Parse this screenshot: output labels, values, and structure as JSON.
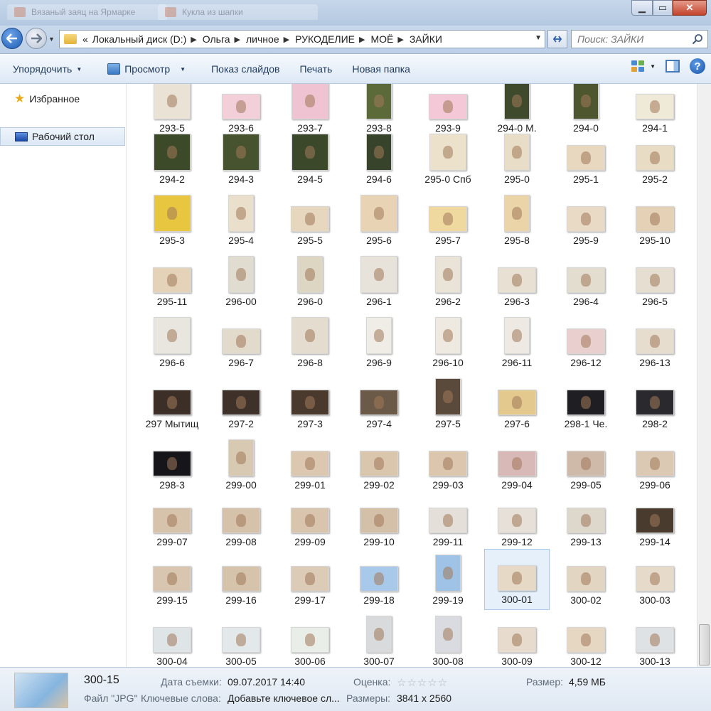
{
  "titlebar": {
    "ghost_tabs": [
      "Вязаный заяц на Ярмарке",
      "Кукла из шапки"
    ]
  },
  "nav": {
    "back_icon": "back-arrow-icon",
    "forward_icon": "forward-arrow-icon"
  },
  "address": {
    "prefix": "«",
    "crumbs": [
      "Локальный диск (D:)",
      "Ольга",
      "личное",
      "РУКОДЕЛИЕ",
      "МОЁ",
      "ЗАЙКИ"
    ]
  },
  "search": {
    "placeholder": "Поиск: ЗАЙКИ"
  },
  "toolbar": {
    "organize": "Упорядочить",
    "view": "Просмотр",
    "slideshow": "Показ слайдов",
    "print": "Печать",
    "new_folder": "Новая папка"
  },
  "sidebar": {
    "favorites": "Избранное",
    "desktop": "Рабочий стол"
  },
  "files": {
    "selected": "300-01",
    "columns": 8,
    "rows": [
      [
        {
          "name": "293-5",
          "shape": "sq",
          "color": "#e9e2d5"
        },
        {
          "name": "293-6",
          "shape": "land",
          "color": "#f2cfd9"
        },
        {
          "name": "293-7",
          "shape": "sq",
          "color": "#efc3d1"
        },
        {
          "name": "293-8",
          "shape": "port",
          "color": "#5c6a3a"
        },
        {
          "name": "293-9",
          "shape": "land",
          "color": "#f4c8d6"
        },
        {
          "name": "294-0 М.",
          "shape": "port",
          "color": "#3f4a2c"
        },
        {
          "name": "294-0",
          "shape": "port",
          "color": "#4e5630"
        },
        {
          "name": "294-1",
          "shape": "land",
          "color": "#efe9d8"
        }
      ],
      [
        {
          "name": "294-2",
          "shape": "sq",
          "color": "#3c4a29"
        },
        {
          "name": "294-3",
          "shape": "sq",
          "color": "#46532e"
        },
        {
          "name": "294-5",
          "shape": "sq",
          "color": "#3b492a"
        },
        {
          "name": "294-6",
          "shape": "port",
          "color": "#37432a"
        },
        {
          "name": "295-0 Спб",
          "shape": "sq",
          "color": "#ece2cc"
        },
        {
          "name": "295-0",
          "shape": "port",
          "color": "#e8ddc6"
        },
        {
          "name": "295-1",
          "shape": "land",
          "color": "#e7d8bf"
        },
        {
          "name": "295-2",
          "shape": "land",
          "color": "#e9dcc4"
        }
      ],
      [
        {
          "name": "295-3",
          "shape": "sq",
          "color": "#e8c640"
        },
        {
          "name": "295-4",
          "shape": "port",
          "color": "#e9dfca"
        },
        {
          "name": "295-5",
          "shape": "land",
          "color": "#e6d7be"
        },
        {
          "name": "295-6",
          "shape": "sq",
          "color": "#e8d4b5"
        },
        {
          "name": "295-7",
          "shape": "land",
          "color": "#f0d99e"
        },
        {
          "name": "295-8",
          "shape": "port",
          "color": "#ead4a8"
        },
        {
          "name": "295-9",
          "shape": "land",
          "color": "#e9dac5"
        },
        {
          "name": "295-10",
          "shape": "land",
          "color": "#e4d1b6"
        }
      ],
      [
        {
          "name": "295-11",
          "shape": "land",
          "color": "#e4d2b9"
        },
        {
          "name": "296-00",
          "shape": "port",
          "color": "#e0ddd0"
        },
        {
          "name": "296-0",
          "shape": "port",
          "color": "#ddd6c3"
        },
        {
          "name": "296-1",
          "shape": "sq",
          "color": "#e7e3da"
        },
        {
          "name": "296-2",
          "shape": "port",
          "color": "#e9e3d8"
        },
        {
          "name": "296-3",
          "shape": "land",
          "color": "#e7e0d3"
        },
        {
          "name": "296-4",
          "shape": "land",
          "color": "#e3ddd0"
        },
        {
          "name": "296-5",
          "shape": "land",
          "color": "#e6dfd1"
        }
      ],
      [
        {
          "name": "296-6",
          "shape": "sq",
          "color": "#e9e6e0"
        },
        {
          "name": "296-7",
          "shape": "land",
          "color": "#e2dacb"
        },
        {
          "name": "296-8",
          "shape": "sq",
          "color": "#e3dccf"
        },
        {
          "name": "296-9",
          "shape": "port",
          "color": "#f0ede6"
        },
        {
          "name": "296-10",
          "shape": "port",
          "color": "#efeae1"
        },
        {
          "name": "296-11",
          "shape": "port",
          "color": "#eeeae3"
        },
        {
          "name": "296-12",
          "shape": "land",
          "color": "#eacfcf"
        },
        {
          "name": "296-13",
          "shape": "land",
          "color": "#e6ddcf"
        }
      ],
      [
        {
          "name": "297 Мытищ",
          "shape": "land",
          "color": "#3b2f27"
        },
        {
          "name": "297-2",
          "shape": "land",
          "color": "#3d3129"
        },
        {
          "name": "297-3",
          "shape": "land",
          "color": "#4a3a2e"
        },
        {
          "name": "297-4",
          "shape": "land",
          "color": "#6b5a48"
        },
        {
          "name": "297-5",
          "shape": "port",
          "color": "#5a4a3b"
        },
        {
          "name": "297-6",
          "shape": "land",
          "color": "#e3c98d"
        },
        {
          "name": "298-1 Че.",
          "shape": "land",
          "color": "#1f1f23"
        },
        {
          "name": "298-2",
          "shape": "land",
          "color": "#2a2a2e"
        }
      ],
      [
        {
          "name": "298-3",
          "shape": "land",
          "color": "#16161a"
        },
        {
          "name": "299-00",
          "shape": "port",
          "color": "#d8c9b2"
        },
        {
          "name": "299-01",
          "shape": "land",
          "color": "#dcc7b0"
        },
        {
          "name": "299-02",
          "shape": "land",
          "color": "#dac5ad"
        },
        {
          "name": "299-03",
          "shape": "land",
          "color": "#dcc6ae"
        },
        {
          "name": "299-04",
          "shape": "land",
          "color": "#d9b8b8"
        },
        {
          "name": "299-05",
          "shape": "land",
          "color": "#cfb9a8"
        },
        {
          "name": "299-06",
          "shape": "land",
          "color": "#dbc9b4"
        }
      ],
      [
        {
          "name": "299-07",
          "shape": "land",
          "color": "#d7c3ac"
        },
        {
          "name": "299-08",
          "shape": "land",
          "color": "#d6c2aa"
        },
        {
          "name": "299-09",
          "shape": "land",
          "color": "#d9c5ae"
        },
        {
          "name": "299-10",
          "shape": "land",
          "color": "#d4c0a8"
        },
        {
          "name": "299-11",
          "shape": "land",
          "color": "#e4dfd8"
        },
        {
          "name": "299-12",
          "shape": "land",
          "color": "#e6e0d8"
        },
        {
          "name": "299-13",
          "shape": "land",
          "color": "#ded7cc"
        },
        {
          "name": "299-14",
          "shape": "land",
          "color": "#4a3b2f"
        }
      ],
      [
        {
          "name": "299-15",
          "shape": "land",
          "color": "#d8c6b0"
        },
        {
          "name": "299-16",
          "shape": "land",
          "color": "#d6c3ac"
        },
        {
          "name": "299-17",
          "shape": "land",
          "color": "#dccbb6"
        },
        {
          "name": "299-18",
          "shape": "land",
          "color": "#a8c9ea"
        },
        {
          "name": "299-19",
          "shape": "port",
          "color": "#9fc3e6"
        },
        {
          "name": "300-01",
          "shape": "land",
          "color": "#e6d9c6"
        },
        {
          "name": "300-02",
          "shape": "land",
          "color": "#e2d5c2"
        },
        {
          "name": "300-03",
          "shape": "land",
          "color": "#e6dacb"
        }
      ],
      [
        {
          "name": "300-04",
          "shape": "land",
          "color": "#dfe4e6"
        },
        {
          "name": "300-05",
          "shape": "land",
          "color": "#e3e8ea"
        },
        {
          "name": "300-06",
          "shape": "land",
          "color": "#e9eee9"
        },
        {
          "name": "300-07",
          "shape": "port",
          "color": "#d8dadb"
        },
        {
          "name": "300-08",
          "shape": "port",
          "color": "#d9dbe0"
        },
        {
          "name": "300-09",
          "shape": "land",
          "color": "#e6dbcc"
        },
        {
          "name": "300-12",
          "shape": "land",
          "color": "#e6d7c2"
        },
        {
          "name": "300-13",
          "shape": "land",
          "color": "#dfe2e5"
        }
      ]
    ]
  },
  "details": {
    "name": "300-15",
    "type": "Файл \"JPG\"",
    "date_label": "Дата съемки:",
    "date_value": "09.07.2017 14:40",
    "keywords_label": "Ключевые слова:",
    "keywords_value": "Добавьте ключевое сл...",
    "rating_label": "Оценка:",
    "rating_stars": "☆☆☆☆☆",
    "dims_label": "Размеры:",
    "dims_value": "3841 x 2560",
    "size_label": "Размер:",
    "size_value": "4,59 МБ"
  }
}
